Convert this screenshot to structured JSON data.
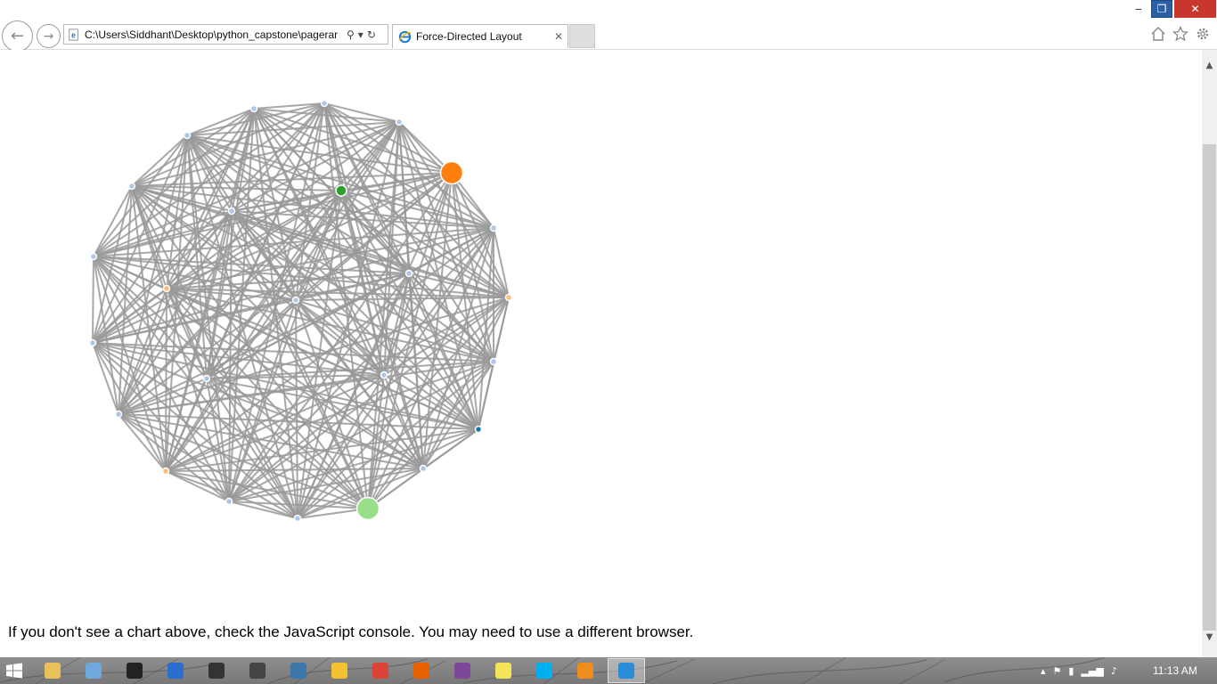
{
  "window": {
    "minimize_glyph": "‒",
    "restore_glyph": "❐",
    "close_glyph": "✕"
  },
  "browser": {
    "address": "C:\\Users\\Siddhant\\Desktop\\python_capstone\\pagerar",
    "search_glyph": "⚲",
    "dropdown_glyph": "▾",
    "refresh_glyph": "↻",
    "tab_title": "Force-Directed Layout",
    "tab_close_glyph": "✕",
    "back_glyph": "←",
    "forward_glyph": "→",
    "toolbar_icons": [
      "home-icon",
      "star-icon",
      "gear-icon"
    ]
  },
  "page": {
    "note": "If you don't see a chart above, check the JavaScript console. You may need to use a different browser."
  },
  "graph": {
    "edge_color": "#999999",
    "node_stroke": "#ffffff",
    "nodes": [
      {
        "color": "#aec7e8",
        "size": "small"
      },
      {
        "color": "#aec7e8",
        "size": "small"
      },
      {
        "color": "#aec7e8",
        "size": "small"
      },
      {
        "color": "#ff7f0e",
        "size": "large"
      },
      {
        "color": "#aec7e8",
        "size": "small"
      },
      {
        "color": "#ffbb78",
        "size": "small"
      },
      {
        "color": "#aec7e8",
        "size": "small"
      },
      {
        "color": "#1f77b4",
        "size": "small"
      },
      {
        "color": "#aec7e8",
        "size": "small"
      },
      {
        "color": "#98df8a",
        "size": "large"
      },
      {
        "color": "#aec7e8",
        "size": "small"
      },
      {
        "color": "#aec7e8",
        "size": "small"
      },
      {
        "color": "#ffbb78",
        "size": "small"
      },
      {
        "color": "#aec7e8",
        "size": "small"
      },
      {
        "color": "#aec7e8",
        "size": "small"
      },
      {
        "color": "#aec7e8",
        "size": "small"
      },
      {
        "color": "#aec7e8",
        "size": "small"
      },
      {
        "color": "#aec7e8",
        "size": "small"
      },
      {
        "color": "#2ca02c",
        "size": "medium"
      },
      {
        "color": "#aec7e8",
        "size": "small"
      },
      {
        "color": "#ffbb78",
        "size": "small"
      },
      {
        "color": "#aec7e8",
        "size": "small"
      },
      {
        "color": "#aec7e8",
        "size": "small"
      },
      {
        "color": "#aec7e8",
        "size": "small"
      },
      {
        "color": "#aec7e8",
        "size": "small"
      }
    ]
  },
  "taskbar": {
    "apps": [
      "file-explorer",
      "photo-viewer",
      "command-prompt",
      "r-gui",
      "terminal",
      "console",
      "python",
      "python-shell",
      "chrome",
      "firefox",
      "tor-browser",
      "sticky-notes",
      "skype",
      "media-player",
      "internet-explorer"
    ],
    "app_colors": [
      "#e8c15a",
      "#6fa8dc",
      "#222222",
      "#2a6fd0",
      "#333333",
      "#444444",
      "#3b77a8",
      "#f2c230",
      "#db4437",
      "#e66000",
      "#7e4798",
      "#f5e35a",
      "#00aff0",
      "#f08c1e",
      "#2b8cd8"
    ],
    "active_app": "internet-explorer",
    "tray_icons": [
      "show-hidden-icons-icon",
      "action-center-icon",
      "battery-icon",
      "network-icon",
      "volume-icon"
    ],
    "clock": "11:13 AM"
  }
}
